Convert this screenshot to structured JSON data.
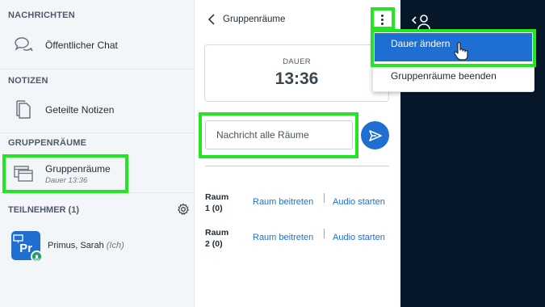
{
  "sidebar": {
    "messages_title": "NACHRICHTEN",
    "public_chat": "Öffentlicher Chat",
    "notes_title": "NOTIZEN",
    "shared_notes": "Geteilte Notizen",
    "breakout_title": "GRUPPENRÄUME",
    "breakout_label": "Gruppenräume",
    "breakout_duration": "Dauer 13:36",
    "users_title": "TEILNEHMER (1)",
    "user": {
      "initials": "Pr",
      "name": "Primus, Sarah",
      "suffix": "(Ich)"
    }
  },
  "panel": {
    "title": "Gruppenräume",
    "timer_label": "DAUER",
    "timer_value": "13:36",
    "message_placeholder": "Nachricht alle Räume",
    "rooms": [
      {
        "line1": "Raum",
        "line2": "1 (0)",
        "join": "Raum beitreten",
        "audio": "Audio starten"
      },
      {
        "line1": "Raum",
        "line2": "2 (0)",
        "join": "Raum beitreten",
        "audio": "Audio starten"
      }
    ]
  },
  "menu": {
    "change_duration": "Dauer ändern",
    "end_breakouts": "Gruppenräume beenden"
  },
  "colors": {
    "accent": "#1f6fd3",
    "highlight": "#22e622",
    "dark_bg": "#06172a",
    "sidebar_bg": "#f3f6f9"
  }
}
